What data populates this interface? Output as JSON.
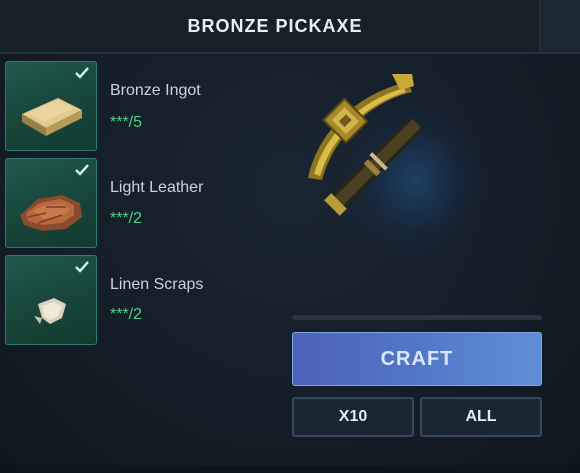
{
  "title": "BRONZE PICKAXE",
  "ingredients": [
    {
      "name": "Bronze Ingot",
      "count": "***/5",
      "icon": "bronze-ingot-icon",
      "complete": true
    },
    {
      "name": "Light Leather",
      "count": "***/2",
      "icon": "leather-icon",
      "complete": true
    },
    {
      "name": "Linen Scraps",
      "count": "***/2",
      "icon": "linen-scrap-icon",
      "complete": true
    }
  ],
  "preview": {
    "item": "bronze-pickaxe-icon"
  },
  "actions": {
    "craft_label": "CRAFT",
    "x10_label": "X10",
    "all_label": "ALL"
  },
  "colors": {
    "ingredient_bg": "#1f5a4e",
    "count_green": "#4fd08a",
    "craft_button": "#5277c7"
  }
}
